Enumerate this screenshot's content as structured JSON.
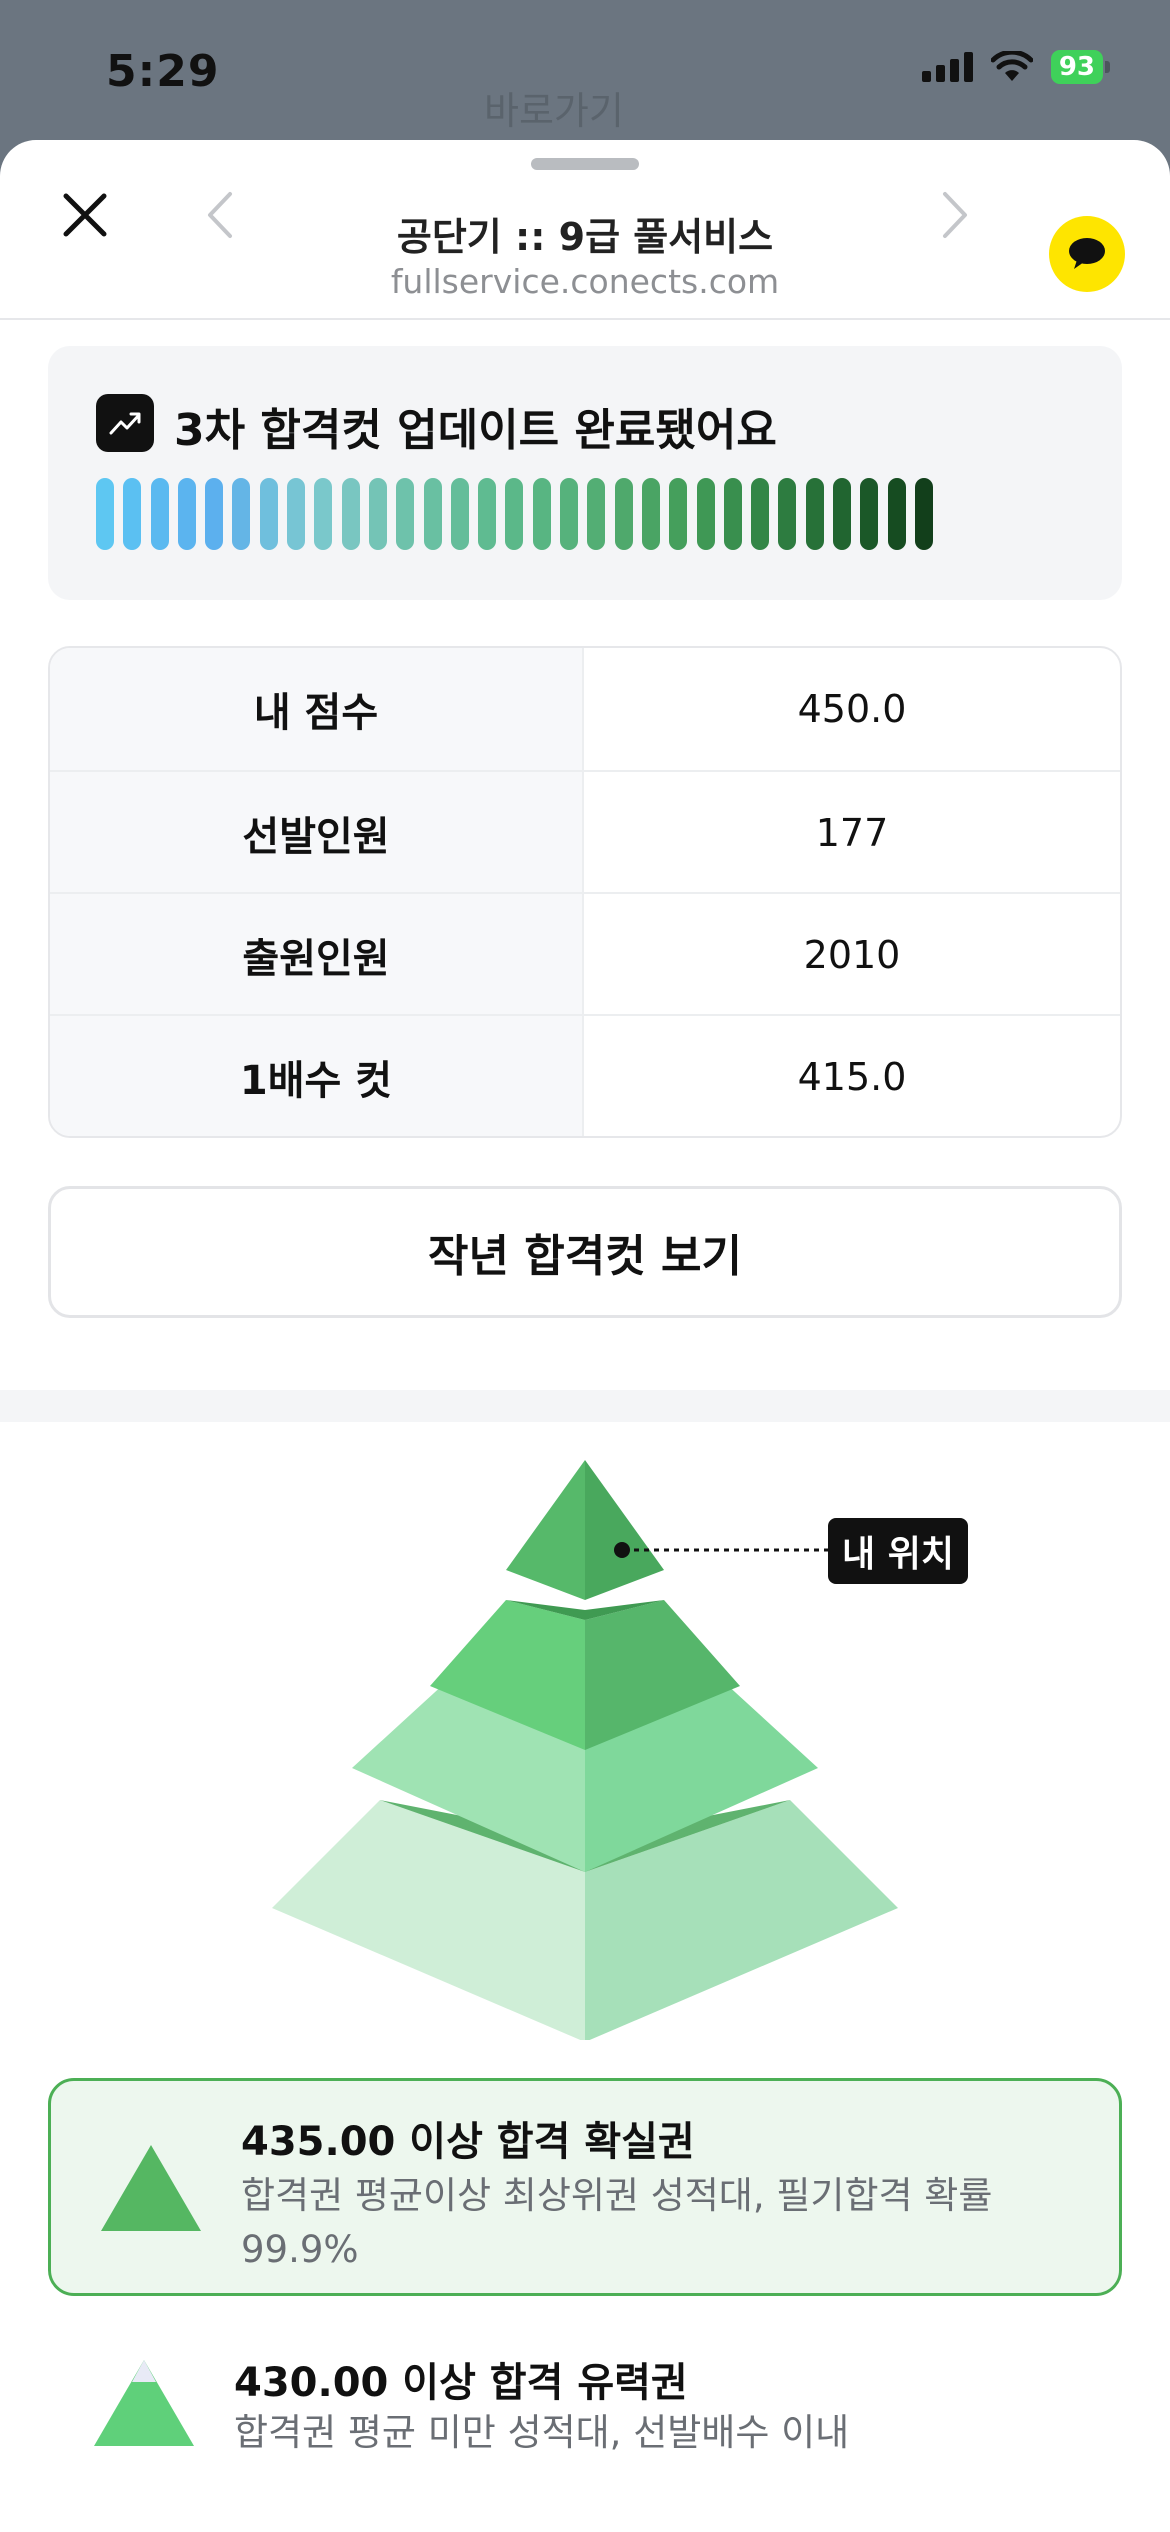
{
  "status_bar": {
    "time": "5:29",
    "battery_percent": "93",
    "behind_title": "바로가기"
  },
  "header": {
    "title": "공단기 :: 9급 풀서비스",
    "url": "fullservice.conects.com",
    "close_icon": "close-icon",
    "prev_icon": "chevron-left-icon",
    "next_icon": "chevron-right-icon",
    "chat_icon": "speech-bubble-icon"
  },
  "update": {
    "icon": "trend-up-icon",
    "message": "3차 합격컷 업데이트 완료됐어요",
    "bar_colors": [
      "#5ec7f2",
      "#5bc0f2",
      "#5ab9f0",
      "#5bb4ef",
      "#5cb0ee",
      "#64b5e6",
      "#6fbfdd",
      "#77c5d4",
      "#7ac8cb",
      "#79c6c1",
      "#74c4b6",
      "#6ec2ab",
      "#69c0a2",
      "#64bd9a",
      "#5fbb91",
      "#5bb889",
      "#58b582",
      "#56b27c",
      "#53ae74",
      "#4fa96c",
      "#4aa464",
      "#459f5c",
      "#3f9855",
      "#398f4e",
      "#338647",
      "#2d7c40",
      "#277138",
      "#216530",
      "#1b5828",
      "#164c21",
      "#123f1b"
    ]
  },
  "stats": [
    {
      "label": "내 점수",
      "value": "450.0"
    },
    {
      "label": "선발인원",
      "value": "177"
    },
    {
      "label": "출원인원",
      "value": "2010"
    },
    {
      "label": "1배수 컷",
      "value": "415.0"
    }
  ],
  "last_year_button": "작년 합격컷 보기",
  "pyramid": {
    "marker_label": "내 위치"
  },
  "tiers": [
    {
      "title": "435.00 이상 합격 확실권",
      "desc": "합격권 평균이상 최상위권 성적대, 필기합격 확률 99.9%",
      "active": true
    },
    {
      "title": "430.00 이상 합격 유력권",
      "desc": "합격권 평균 미만 성적대, 선발배수 이내",
      "active": false
    }
  ],
  "colors": {
    "accent_green": "#4caf55",
    "kakao_yellow": "#fee500"
  }
}
